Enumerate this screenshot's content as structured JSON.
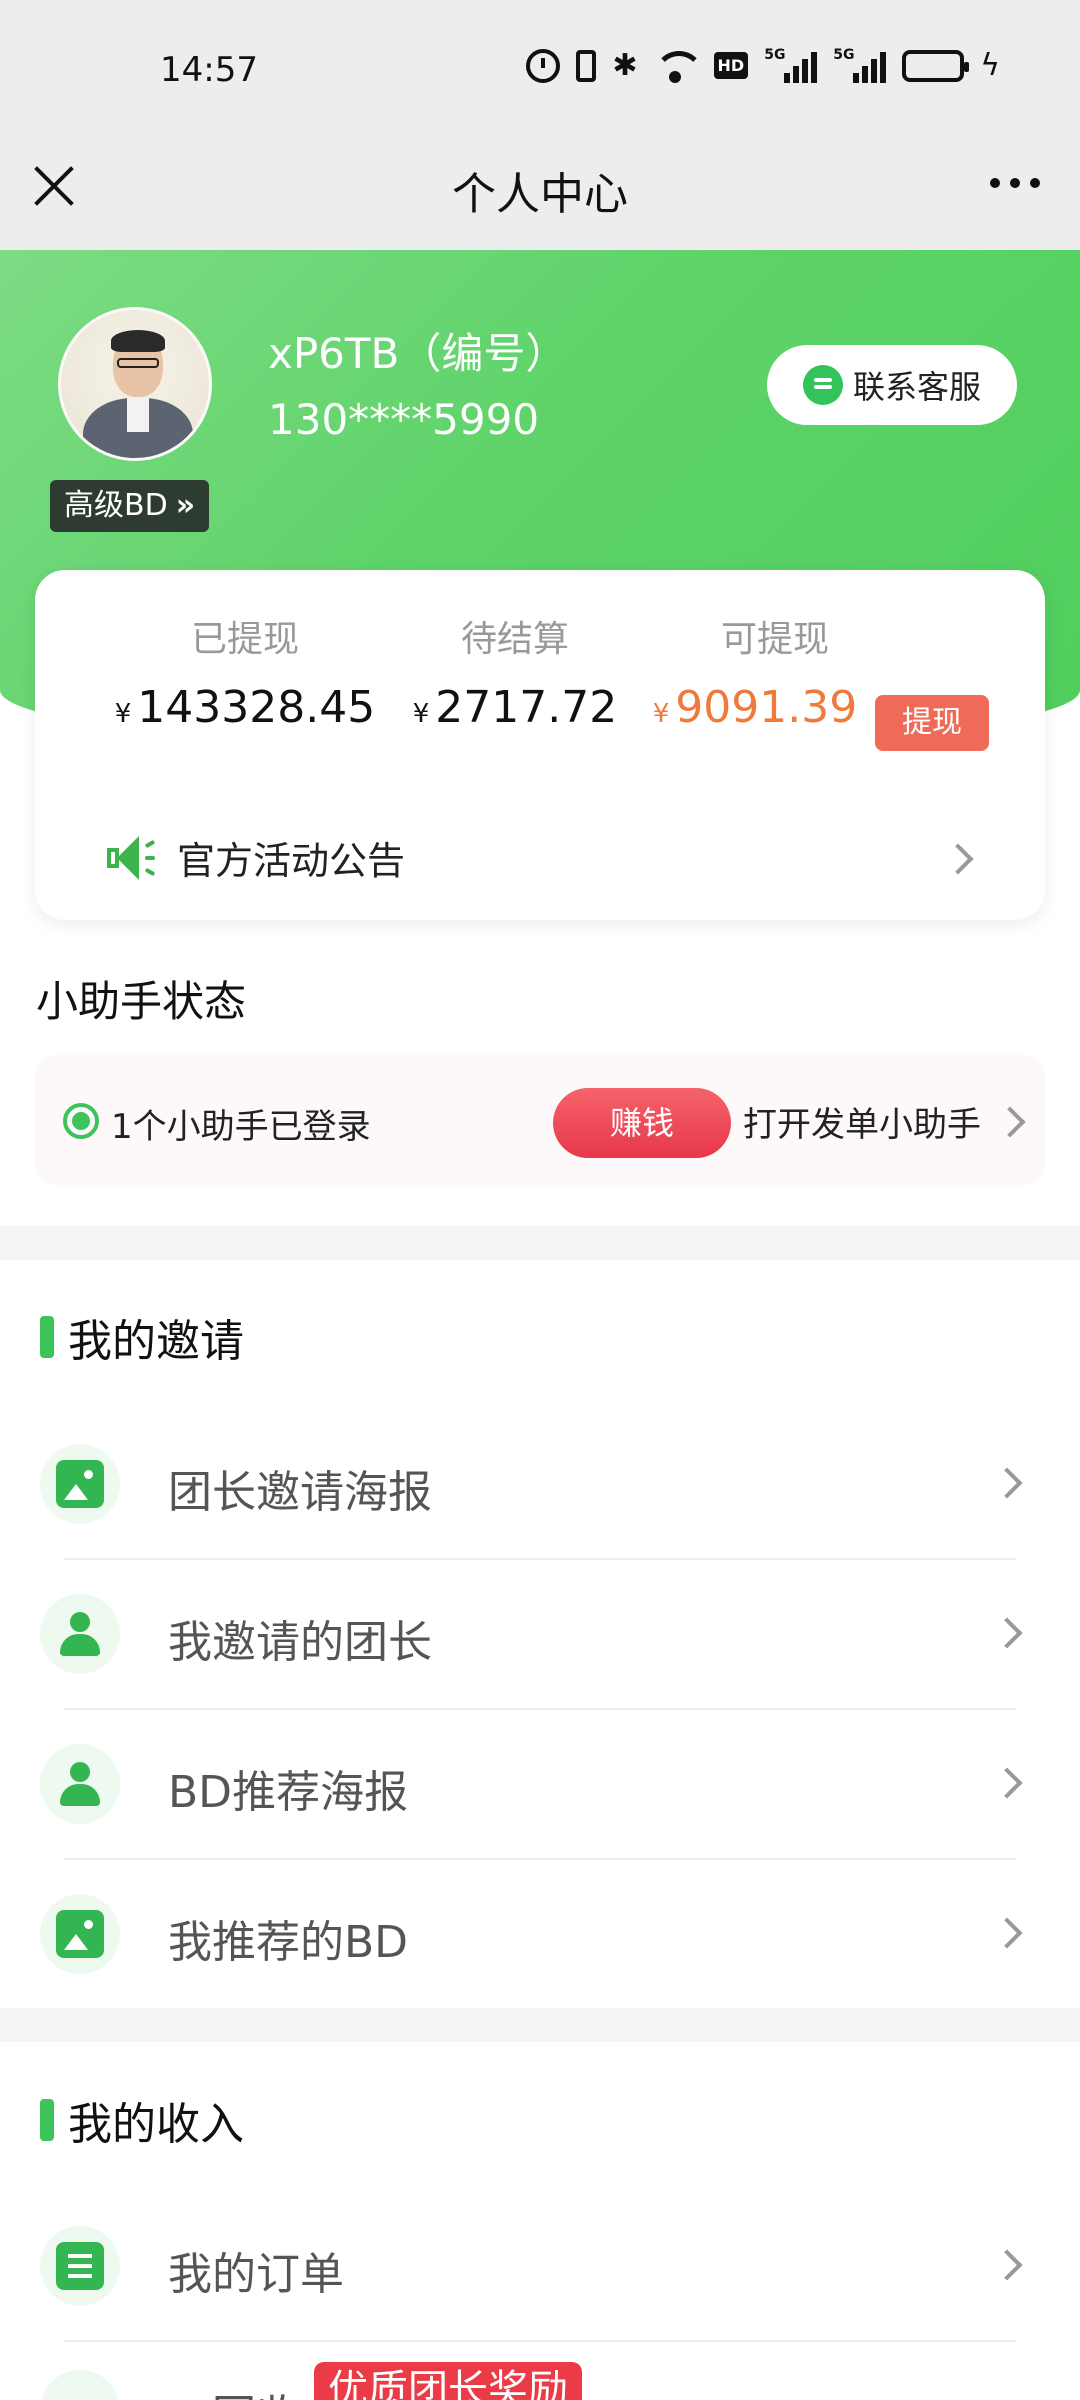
{
  "status_bar": {
    "time": "14:57",
    "hd_label": "HD",
    "signal_label_1": "5G",
    "signal_label_2": "5G",
    "icons": [
      "alarm-icon",
      "vibrate-icon",
      "bluetooth-icon",
      "wifi-icon",
      "hd-icon",
      "signal-5g-icon",
      "signal-5g-icon",
      "battery-icon",
      "charging-icon"
    ]
  },
  "nav": {
    "title": "个人中心",
    "close_icon": "close-icon",
    "more_icon": "more-icon"
  },
  "profile": {
    "name": "xP6TB（编号）",
    "phone": "130****5990",
    "level": "高级BD",
    "level_chevron": "»",
    "contact_label": "联系客服"
  },
  "earnings": {
    "currency": "¥",
    "withdrawn_label": "已提现",
    "withdrawn_value": "143328.45",
    "pending_label": "待结算",
    "pending_value": "2717.72",
    "available_label": "可提现",
    "available_value": "9091.39",
    "withdraw_button": "提现",
    "announcement": "官方活动公告"
  },
  "helper": {
    "section_title": "小助手状态",
    "status_text": "1个小助手已登录",
    "earn_button": "赚钱",
    "open_label": "打开发单小助手"
  },
  "invite": {
    "section_title": "我的邀请",
    "items": [
      {
        "label": "团长邀请海报",
        "icon": "image-icon"
      },
      {
        "label": "我邀请的团长",
        "icon": "users-icon"
      },
      {
        "label": "BD推荐海报",
        "icon": "user-share-icon"
      },
      {
        "label": "我推荐的BD",
        "icon": "poster-icon"
      }
    ]
  },
  "income": {
    "section_title": "我的收入",
    "items": [
      {
        "label": "我的订单",
        "icon": "order-icon"
      }
    ],
    "partial_label": "二回收",
    "promo_tag": "优质团长奖励"
  },
  "colors": {
    "brand_green": "#4fce5d",
    "accent_orange": "#f07a3b",
    "withdraw_red": "#ef6b58",
    "earn_red": "#e8374a"
  }
}
